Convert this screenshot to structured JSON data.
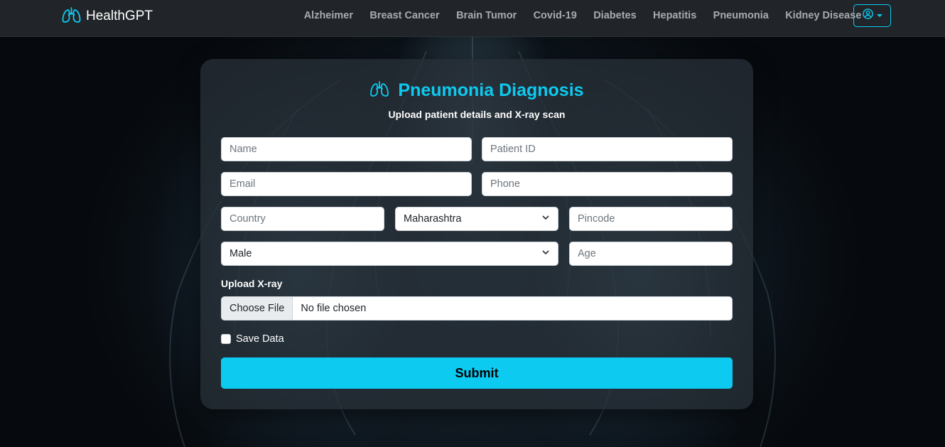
{
  "navbar": {
    "brand": "HealthGPT",
    "links": [
      "Alzheimer",
      "Breast Cancer",
      "Brain Tumor",
      "Covid-19",
      "Diabetes",
      "Hepatitis",
      "Pneumonia",
      "Kidney Disease"
    ],
    "user_icon": "user-circle-icon"
  },
  "form": {
    "title": "Pneumonia Diagnosis",
    "subtitle": "Upload patient details and X-ray scan",
    "name_placeholder": "Name",
    "patient_id_placeholder": "Patient ID",
    "email_placeholder": "Email",
    "phone_placeholder": "Phone",
    "country_placeholder": "Country",
    "state_selected": "Maharashtra",
    "pincode_placeholder": "Pincode",
    "gender_selected": "Male",
    "age_placeholder": "Age",
    "upload_label": "Upload X-ray",
    "file_button": "Choose File",
    "file_status": "No file chosen",
    "save_label": "Save Data",
    "save_checked": false,
    "submit_label": "Submit"
  },
  "colors": {
    "accent": "#0dcaf0",
    "navbar_bg": "#212529",
    "card_bg": "#262e36"
  }
}
